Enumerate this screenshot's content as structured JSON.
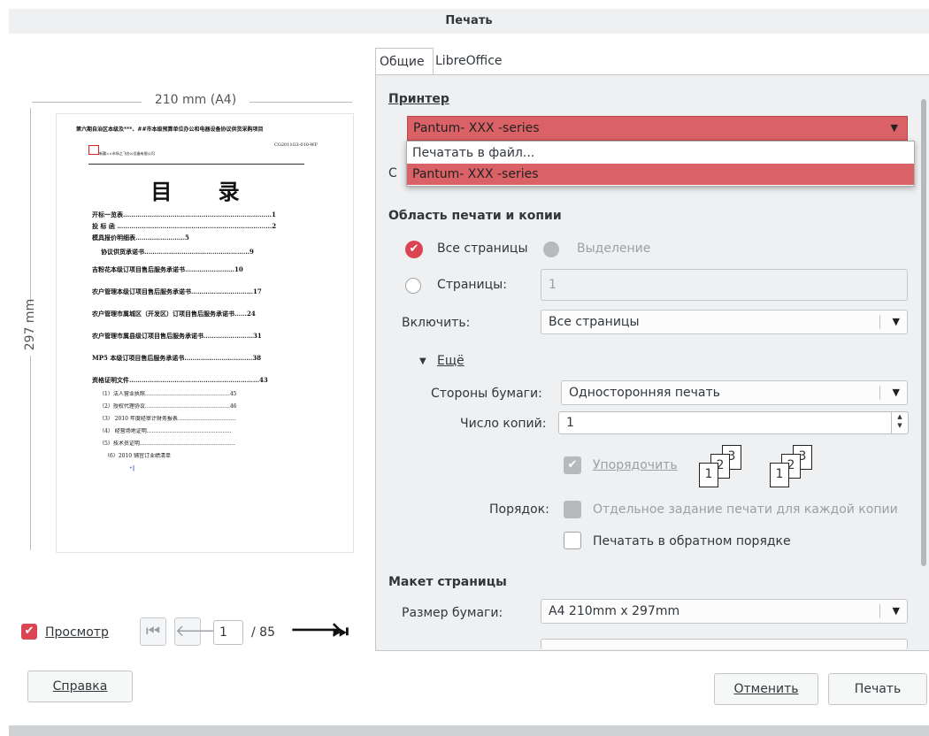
{
  "window": {
    "title": "Печать"
  },
  "preview": {
    "width_label": "210 mm (A4)",
    "height_label": "297 mm",
    "doc": {
      "header": "第六期自治区本级及***、##市本级预算单位办公和电器设备协议供货采购项目",
      "code": "CG2011G3-010-WF",
      "company": "新疆××市场之飞办公设备有限公司",
      "title": "目 录",
      "toc": [
        "开标一览表………………………………………………………………1",
        "投 标 函 …………………………………………………………………2",
        "模具报价明细表……………………5",
        "协议供货承诺书……………………………………………9",
        "吉粉花本级订项目售后服务承诺书……………………10",
        "农户管理本级订项目售后服务承诺书…………………………17",
        "农户管理市属城区（开发区）订项目售后服务承诺书……24",
        "农户管理市属县级订项目售后服务承诺书……………………31",
        "MP5 本级订项目售后服务承诺书……………………………38",
        "资格证明文件………………………………………………………43"
      ],
      "toc_sub": [
        "（1）法人营业执照…………………………………………45",
        "（2）授权代理协议…………………………………………46",
        "（3） 2010 年度经审计财务报表……………………………",
        "（4） 经营场地证明…………………………………………",
        "（5）技术员证明………………………………………………",
        "（6）2010 铺宫订业绩清单",
        "•‖"
      ]
    },
    "checkbox_label": "Просмотр",
    "page_current": "1",
    "page_total": "/ 85"
  },
  "tabs": [
    "Общие",
    "LibreOffice Writer"
  ],
  "printer": {
    "section": "Принтер",
    "selected": "Pantum-  XXX       -series",
    "options": [
      "Печатать в файл...",
      "Pantum-  XXX       -series"
    ],
    "hidden_label_fragment": "С"
  },
  "range": {
    "section": "Область печати и копии",
    "all_pages": "Все страницы",
    "selection": "Выделение",
    "pages": "Страницы:",
    "pages_value": "1",
    "include_label": "Включить:",
    "include_value": "Все страницы",
    "more": "Ещё",
    "sides_label": "Стороны бумаги:",
    "sides_value": "Односторонняя печать",
    "copies_label": "Число копий:",
    "copies_value": "1",
    "collate": "Упорядочить",
    "order_label": "Порядок:",
    "separate_jobs": "Отдельное задание печати для каждой копии",
    "reverse": "Печатать в обратном порядке"
  },
  "layout": {
    "section": "Макет страницы",
    "paper_label": "Размер бумаги:",
    "paper_value": "A4 210mm x 297mm"
  },
  "buttons": {
    "help": "Справка",
    "cancel": "Отменить",
    "print": "Печать"
  },
  "colors": {
    "accent": "#da4453",
    "selection": "#da6166",
    "panel": "#eff0f1"
  },
  "icons": [
    "first-page-icon",
    "prev-page-icon",
    "next-page-icon",
    "last-page-icon",
    "collate-icon",
    "dropdown-arrow-icon",
    "checkmark-icon",
    "expand-triangle-icon"
  ]
}
